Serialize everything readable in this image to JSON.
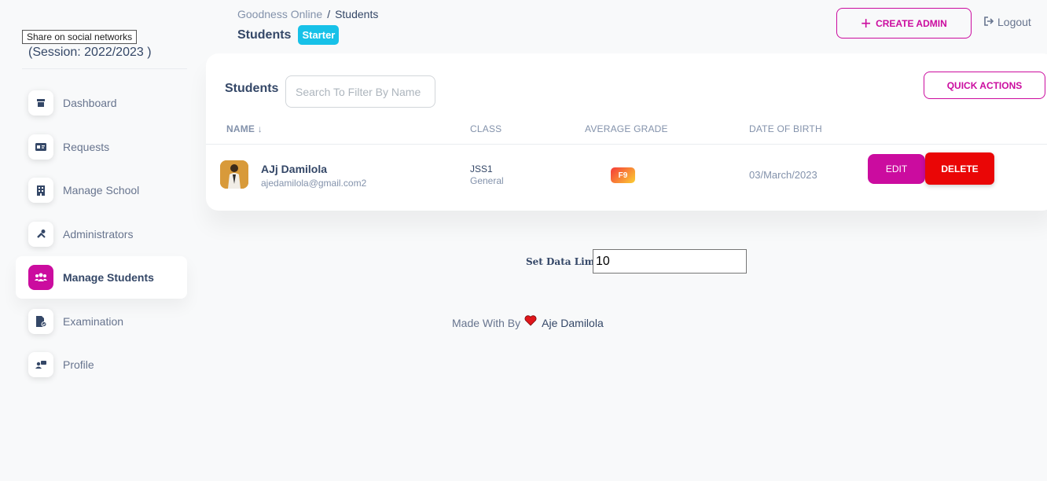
{
  "sidebar": {
    "session": "(Session: 2022/2023 )",
    "tooltip": "Share on social networks",
    "items": [
      {
        "label": "Dashboard",
        "icon": "shop-icon",
        "active": false
      },
      {
        "label": "Requests",
        "icon": "id-card-icon",
        "active": false
      },
      {
        "label": "Manage School",
        "icon": "building-icon",
        "active": false
      },
      {
        "label": "Administrators",
        "icon": "tools-icon",
        "active": false
      },
      {
        "label": "Manage Students",
        "icon": "users-icon",
        "active": true
      },
      {
        "label": "Examination",
        "icon": "file-check-icon",
        "active": false
      },
      {
        "label": "Profile",
        "icon": "user-card-icon",
        "active": false
      }
    ]
  },
  "header": {
    "breadcrumb_root": "Goodness Online",
    "breadcrumb_separator": "/",
    "breadcrumb_current": "Students",
    "title": "Students",
    "plan_badge": "Starter",
    "create_admin_label": "CREATE ADMIN",
    "logout_label": "Logout"
  },
  "card": {
    "title": "Students",
    "search_placeholder": "Search To Filter By Name",
    "quick_actions_label": "QUICK ACTIONS",
    "columns": {
      "name": "NAME",
      "sort_indicator": "↓",
      "class": "CLASS",
      "average_grade": "AVERAGE GRADE",
      "date_of_birth": "DATE OF BIRTH"
    },
    "rows": [
      {
        "name": "AJj Damilola",
        "email": "ajedamilola@gmail.com2",
        "class": "JSS1",
        "class_type": "General",
        "grade": "F9",
        "dob": "03/March/2023",
        "edit_label": "EDIT",
        "delete_label": "DELETE"
      }
    ]
  },
  "data_limit": {
    "label": "Set Data Limit",
    "value": "10"
  },
  "footer": {
    "prefix": "Made With By",
    "author": "Aje Damilola"
  },
  "colors": {
    "primary": "#cb0c9f",
    "danger": "#ea0606",
    "info": "#17c1e8",
    "text_dark": "#344767",
    "text_muted": "#8392ab"
  }
}
